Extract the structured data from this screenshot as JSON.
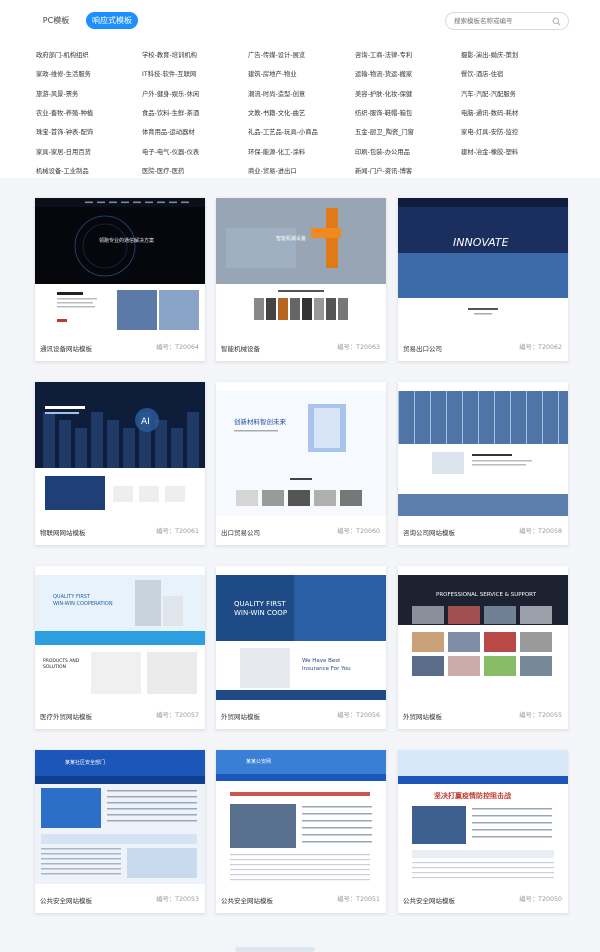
{
  "tabs": [
    {
      "label": "PC模板",
      "active": false
    },
    {
      "label": "响应式模板",
      "active": true
    }
  ],
  "search": {
    "placeholder": "搜索模板名称或编号"
  },
  "categories": [
    [
      "政府部门-机构组织",
      "学校-教育-培训机构",
      "广告-传媒-设计-展览",
      "咨询-工商-法律-专利",
      "摄影-演出-婚庆-策划"
    ],
    [
      "家政-维修-生活服务",
      "IT科技-软件-互联网",
      "建筑-房地产-物业",
      "运输-物流-货运-搬家",
      "餐饮-酒店-住宿"
    ],
    [
      "旅游-风景-票务",
      "户外-健身-娱乐-休闲",
      "潮流-时尚-造型-创意",
      "美容-护肤-化妆-保健",
      "汽车-汽配-汽配服务"
    ],
    [
      "农业-畜牧-养殖-种植",
      "食品-饮料-生鲜-茶酒",
      "文教-书籍-文化-曲艺",
      "纺织-服饰-鞋帽-箱包",
      "电脑-通讯-数码-耗材"
    ],
    [
      "珠宝-首饰-钟表-配饰",
      "体育用品-运动器材",
      "礼品-工艺品-玩具-小商品",
      "五金-厨卫_陶瓷_门窗",
      "家电-灯具-安防-监控"
    ],
    [
      "家具-家居-日用百货",
      "电子-电气-仪器-仪表",
      "环保-能源-化工-涂料",
      "印刷-包装-办公用品",
      "建材-冶金-橡胶-塑料"
    ],
    [
      "机械设备-工业制品",
      "医院-医疗-医药",
      "商业-贸易-进出口",
      "新闻-门户-资讯-博客",
      ""
    ]
  ],
  "templates": [
    {
      "name": "通讯设备网站模板",
      "number": "编号：T20064",
      "theme": "dark-globe",
      "banner": "领跑专业的通信解决方案"
    },
    {
      "name": "智能机械设备",
      "number": "编号：T20063",
      "theme": "robot",
      "banner": "智能机械设备"
    },
    {
      "name": "贸易出口公司",
      "number": "编号：T20062",
      "theme": "innovate",
      "banner": "INNOVATE"
    },
    {
      "name": "物联网网站模板",
      "number": "编号：T20061",
      "theme": "ai-city",
      "banner": "AI"
    },
    {
      "name": "出口贸易公司",
      "number": "编号：T20060",
      "theme": "building",
      "banner": "创新材料智创未来"
    },
    {
      "name": "咨询公司网站模板",
      "number": "编号：T20058",
      "theme": "glass",
      "banner": "咨询公司"
    },
    {
      "name": "医疗外贸网站模板",
      "number": "编号：T20057",
      "theme": "lab",
      "banner": "QUALITY FIRST WIN-WIN COOPERATION"
    },
    {
      "name": "外贸网站模板",
      "number": "编号：T20056",
      "theme": "business",
      "banner": "QUALITY FIRST WIN-WIN COOPERATION"
    },
    {
      "name": "外贸网站模板",
      "number": "编号：T20055",
      "theme": "factory",
      "banner": "PROFESSIONAL SERVICE & SUPPORT"
    },
    {
      "name": "公共安全网站模板",
      "number": "编号：T20053",
      "theme": "gov-blue",
      "banner": "某某社区安全部门"
    },
    {
      "name": "公共安全网站模板",
      "number": "编号：T20051",
      "theme": "gov-news",
      "banner": "某某公安网"
    },
    {
      "name": "公共安全网站模板",
      "number": "编号：T20050",
      "theme": "gov-red",
      "banner": "坚决打赢疫情防控阻击战"
    }
  ],
  "colors": {
    "accent": "#1e8fff",
    "card_bg": "#ffffff",
    "page_bg": "#f3f5f8"
  }
}
